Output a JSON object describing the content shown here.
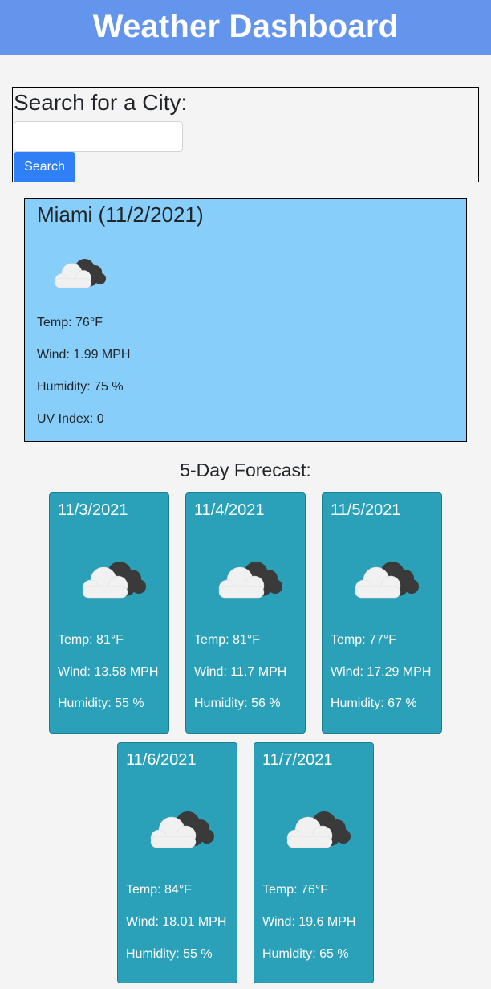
{
  "header": {
    "title": "Weather Dashboard"
  },
  "search": {
    "heading": "Search for a City:",
    "input_value": "",
    "placeholder": "",
    "button_label": "Search"
  },
  "current": {
    "title": "Miami (11/2/2021)",
    "icon": "cloudy-icon",
    "temp": "Temp: 76°F",
    "wind": "Wind: 1.99 MPH",
    "humidity": "Humidity: 75 %",
    "uv": "UV Index: 0"
  },
  "forecast": {
    "title": "5-Day Forecast:",
    "days": [
      {
        "date": "11/3/2021",
        "icon": "cloudy-icon",
        "temp": "Temp: 81°F",
        "wind": "Wind: 13.58 MPH",
        "humidity": "Humidity: 55 %"
      },
      {
        "date": "11/4/2021",
        "icon": "cloudy-icon",
        "temp": "Temp: 81°F",
        "wind": "Wind: 11.7 MPH",
        "humidity": "Humidity: 56 %"
      },
      {
        "date": "11/5/2021",
        "icon": "cloudy-icon",
        "temp": "Temp: 77°F",
        "wind": "Wind: 17.29 MPH",
        "humidity": "Humidity: 67 %"
      },
      {
        "date": "11/6/2021",
        "icon": "cloudy-icon",
        "temp": "Temp: 84°F",
        "wind": "Wind: 18.01 MPH",
        "humidity": "Humidity: 55 %"
      },
      {
        "date": "11/7/2021",
        "icon": "cloudy-icon",
        "temp": "Temp: 76°F",
        "wind": "Wind: 19.6 MPH",
        "humidity": "Humidity: 65 %"
      }
    ]
  },
  "colors": {
    "header_bg": "#6495ed",
    "search_button": "#2f7ff6",
    "current_bg": "#87cefa",
    "card_bg": "#2aa1b9"
  }
}
